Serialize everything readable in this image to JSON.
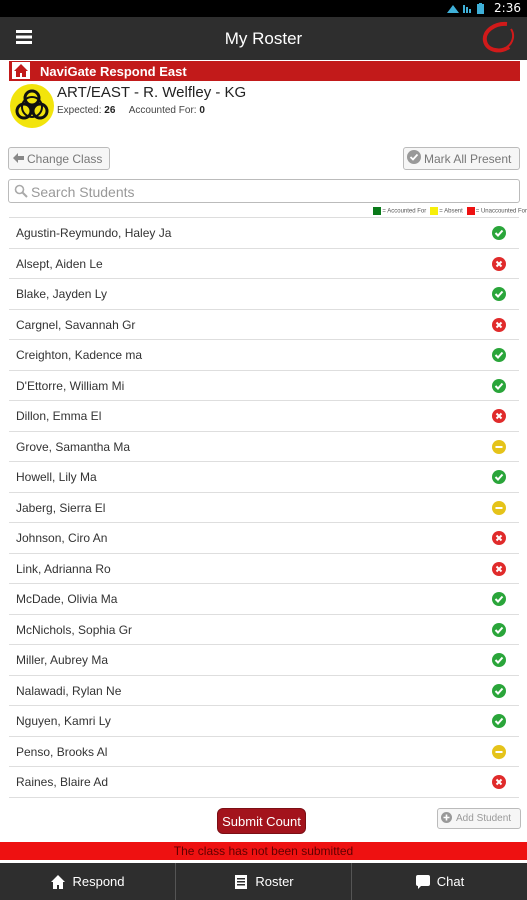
{
  "statusbar": {
    "time": "2:36"
  },
  "appbar": {
    "title": "My Roster"
  },
  "school_bar": {
    "label": "NaviGate Respond East"
  },
  "class_info": {
    "name": "ART/EAST - R. Welfley - KG",
    "expected_label": "Expected:",
    "expected_value": "26",
    "accounted_label": "Accounted For:",
    "accounted_value": "0"
  },
  "buttons": {
    "change_class": "Change Class",
    "mark_all_present": "Mark All Present",
    "submit_count": "Submit Count",
    "add_student": "Add Student"
  },
  "search": {
    "placeholder": "Search Students"
  },
  "legend": {
    "accounted": "= Accounted For",
    "absent": "= Absent",
    "unaccounted": "= Unaccounted For"
  },
  "colors": {
    "accounted": "#2aa53a",
    "absent": "#e5c31a",
    "unaccounted": "#e02b2b",
    "brand_red": "#c21a1a"
  },
  "students": [
    {
      "name": "Agustin-Reymundo, Haley Ja",
      "status": "accounted"
    },
    {
      "name": "Alsept, Aiden Le",
      "status": "unaccounted"
    },
    {
      "name": "Blake, Jayden Ly",
      "status": "accounted"
    },
    {
      "name": "Cargnel, Savannah Gr",
      "status": "unaccounted"
    },
    {
      "name": "Creighton, Kadence ma",
      "status": "accounted"
    },
    {
      "name": "D'Ettorre, William Mi",
      "status": "accounted"
    },
    {
      "name": "Dillon, Emma El",
      "status": "unaccounted"
    },
    {
      "name": "Grove, Samantha Ma",
      "status": "absent"
    },
    {
      "name": "Howell, Lily Ma",
      "status": "accounted"
    },
    {
      "name": "Jaberg, Sierra El",
      "status": "absent"
    },
    {
      "name": "Johnson, Ciro An",
      "status": "unaccounted"
    },
    {
      "name": "Link, Adrianna Ro",
      "status": "unaccounted"
    },
    {
      "name": "McDade, Olivia Ma",
      "status": "accounted"
    },
    {
      "name": "McNichols, Sophia Gr",
      "status": "accounted"
    },
    {
      "name": "Miller, Aubrey Ma",
      "status": "accounted"
    },
    {
      "name": "Nalawadi, Rylan Ne",
      "status": "accounted"
    },
    {
      "name": "Nguyen, Kamri Ly",
      "status": "accounted"
    },
    {
      "name": "Penso, Brooks Al",
      "status": "absent"
    },
    {
      "name": "Raines, Blaire Ad",
      "status": "unaccounted"
    }
  ],
  "notice": "The class has not been submitted",
  "tabs": [
    {
      "label": "Respond",
      "icon": "home-icon"
    },
    {
      "label": "Roster",
      "icon": "roster-icon"
    },
    {
      "label": "Chat",
      "icon": "chat-icon"
    }
  ]
}
